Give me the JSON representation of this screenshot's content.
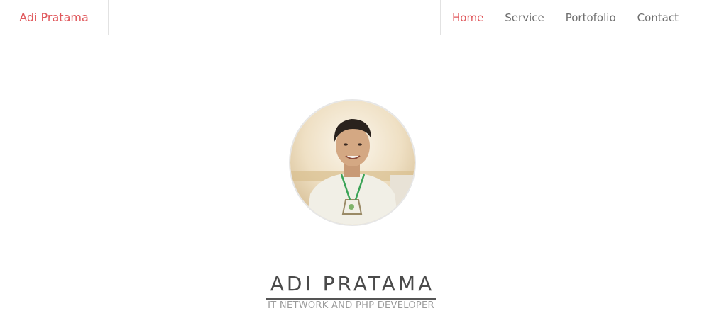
{
  "navbar": {
    "brand": "Adi Pratama",
    "items": [
      {
        "label": "Home",
        "active": true
      },
      {
        "label": "Service",
        "active": false
      },
      {
        "label": "Portofolio",
        "active": false
      },
      {
        "label": "Contact",
        "active": false
      }
    ]
  },
  "hero": {
    "name": "ADI PRATAMA",
    "subtitle": "IT NETWORK AND PHP DEVELOPER"
  },
  "colors": {
    "accent": "#e0575b",
    "nav_text": "#6e6e6e",
    "title_text": "#4a4a4a",
    "subtitle_text": "#9a9a9a"
  }
}
